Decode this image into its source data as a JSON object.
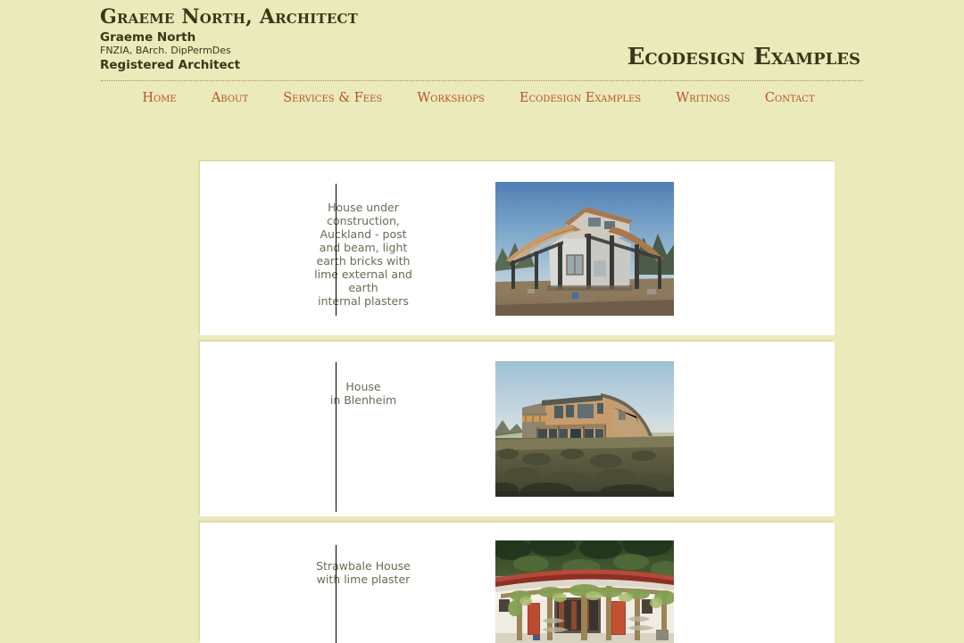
{
  "header": {
    "site_title": "Graeme North, Architect",
    "person_name": "Graeme North",
    "qualifications": "FNZIA, BArch. DipPermDes",
    "registration": "Registered Architect",
    "page_heading": "Ecodesign Examples"
  },
  "nav": {
    "items": [
      {
        "label": "Home"
      },
      {
        "label": "About"
      },
      {
        "label": "Services & Fees"
      },
      {
        "label": "Workshops"
      },
      {
        "label": "Ecodesign Examples"
      },
      {
        "label": "Writings"
      },
      {
        "label": "Contact"
      }
    ]
  },
  "colors": {
    "page_background": "#ebeaba",
    "panel_background": "#ffffff",
    "heading_text": "#3a3718",
    "nav_link": "#b5522e",
    "caption_text": "#6b6a55",
    "rule": "#a98f6b",
    "divider": "#000000"
  },
  "examples": [
    {
      "caption_lines": [
        "House under",
        "construction,",
        "Auckland - post",
        "and beam, light",
        "earth bricks with",
        "lime external and",
        "earth",
        "internal plasters"
      ],
      "photo_alt": "House under construction with curved roof, dark timber posts and pale plastered walls on a bare earth site under blue sky"
    },
    {
      "caption_lines": [
        "House",
        "in Blenheim"
      ],
      "photo_alt": "Two storey earth house with sweeping curved roof and tan plastered walls set in dry scrubland"
    },
    {
      "caption_lines": [
        "Strawbale House",
        "with lime plaster"
      ],
      "photo_alt": "Strawbale house with red roof edge, white lime plastered walls, vine covered pergola and red doors against dark bush"
    }
  ]
}
